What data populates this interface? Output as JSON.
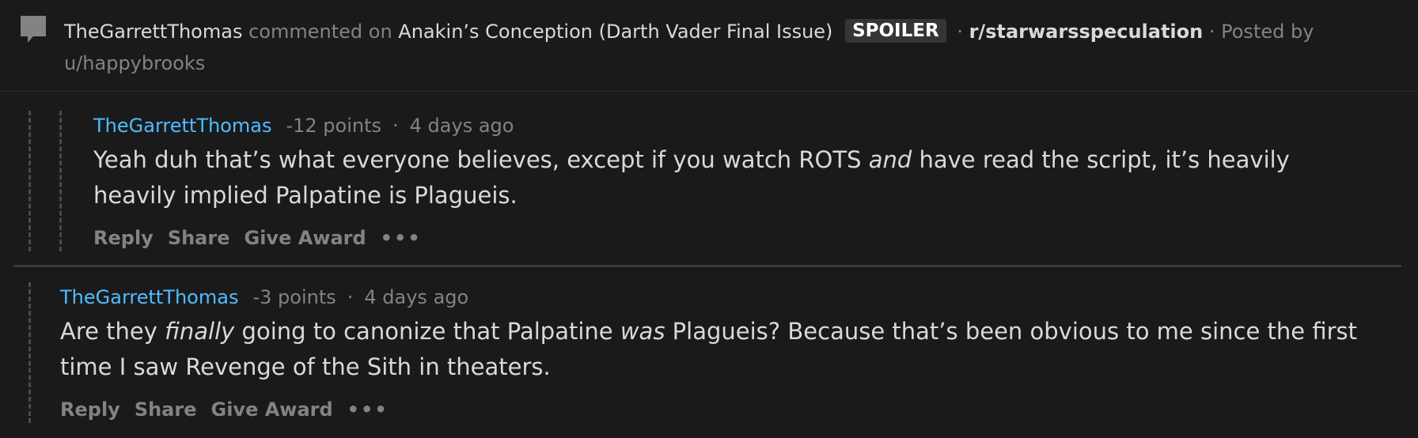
{
  "header": {
    "user": "TheGarrettThomas",
    "commented_on": "commented on",
    "post_title": "Anakin’s Conception (Darth Vader Final Issue)",
    "spoiler_tag": "SPOILER",
    "separator": "·",
    "subreddit": "r/starwarsspeculation",
    "posted_by": "· Posted by",
    "op": "u/happybrooks"
  },
  "comments": [
    {
      "author": "TheGarrettThomas",
      "points": "-12 points",
      "dot": "·",
      "time": "4 days ago",
      "body_part1": "Yeah duh that’s what everyone believes, except if you watch ROTS ",
      "body_em": "and",
      "body_part2": " have read the script, it’s heavily heavily implied Palpatine is Plagueis."
    },
    {
      "author": "TheGarrettThomas",
      "points": "-3 points",
      "dot": "·",
      "time": "4 days ago",
      "body_part1": "Are they ",
      "body_em1": "finally",
      "body_part2": " going to canonize that Palpatine ",
      "body_em2": "was",
      "body_part3": " Plagueis? Because that’s been obvious to me since the first time I saw Revenge of the Sith in theaters."
    }
  ],
  "actions": {
    "reply": "Reply",
    "share": "Share",
    "give_award": "Give Award",
    "more": "•••"
  }
}
